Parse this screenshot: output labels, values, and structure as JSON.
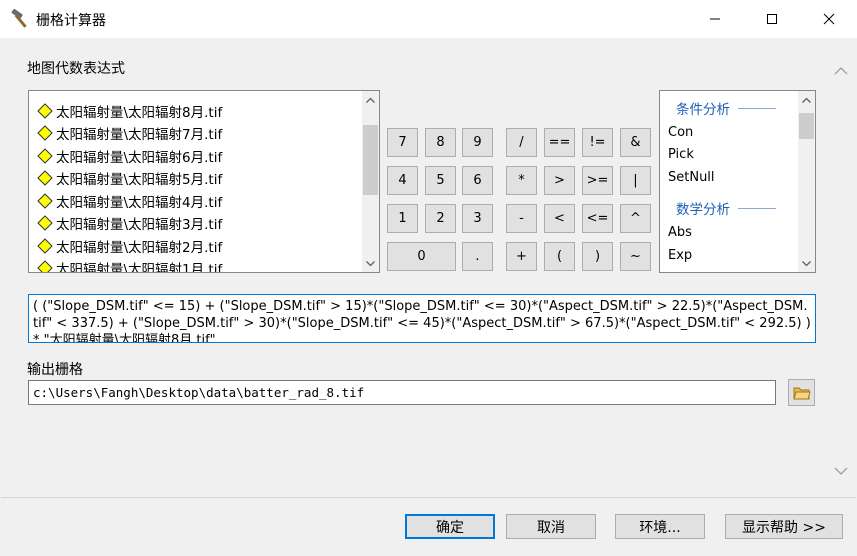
{
  "window": {
    "title": "栅格计算器",
    "minimize_glyph": "—",
    "maximize_glyph": "☐",
    "close_glyph": "✕"
  },
  "map_algebra": {
    "label": "地图代数表达式",
    "layers": [
      "太阳辐射量\\太阳辐射8月.tif",
      "太阳辐射量\\太阳辐射7月.tif",
      "太阳辐射量\\太阳辐射6月.tif",
      "太阳辐射量\\太阳辐射5月.tif",
      "太阳辐射量\\太阳辐射4月.tif",
      "太阳辐射量\\太阳辐射3月.tif",
      "太阳辐射量\\太阳辐射2月.tif",
      "太阳辐射量\\太阳辐射1月.tif"
    ]
  },
  "keypad": {
    "rows": [
      [
        "7",
        "8",
        "9",
        "/",
        "==",
        "!=",
        "&"
      ],
      [
        "4",
        "5",
        "6",
        "*",
        ">",
        ">=",
        "|"
      ],
      [
        "1",
        "2",
        "3",
        "-",
        "<",
        "<=",
        "^"
      ],
      [
        "0",
        ".",
        "+",
        "(",
        ")",
        "~"
      ]
    ]
  },
  "functions": {
    "group1": "条件分析",
    "group1_items": [
      "Con",
      "Pick",
      "SetNull"
    ],
    "group2": "数学分析",
    "group2_items": [
      "Abs",
      "Exp"
    ]
  },
  "expression": {
    "value": "( (\"Slope_DSM.tif\" <= 15) + (\"Slope_DSM.tif\" > 15)*(\"Slope_DSM.tif\" <= 30)*(\"Aspect_DSM.tif\" > 22.5)*(\"Aspect_DSM.tif\" < 337.5) + (\"Slope_DSM.tif\" > 30)*(\"Slope_DSM.tif\" <= 45)*(\"Aspect_DSM.tif\" > 67.5)*(\"Aspect_DSM.tif\" < 292.5) ) * \"太阳辐射量\\太阳辐射8月.tif\""
  },
  "output": {
    "label": "输出栅格",
    "value": "c:\\Users\\Fangh\\Desktop\\data\\batter_rad_8.tif"
  },
  "footer": {
    "ok": "确定",
    "cancel": "取消",
    "environments": "环境...",
    "show_help": "显示帮助 >>"
  },
  "colors": {
    "accent": "#0078d7",
    "function_header": "#1e5fb4",
    "layer_icon": "#ffff00"
  },
  "icons": {
    "title": "hammer-icon",
    "layer": "raster-layer-diamond-icon",
    "browse": "open-folder-icon"
  }
}
